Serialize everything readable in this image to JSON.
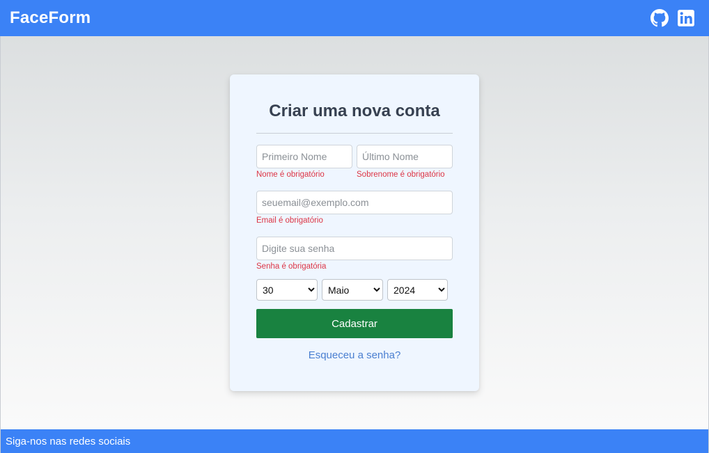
{
  "app": {
    "brand": "FaceForm"
  },
  "header": {
    "social_icons": [
      "github-icon",
      "linkedin-icon"
    ]
  },
  "form": {
    "title": "Criar uma nova conta",
    "first_name": {
      "placeholder": "Primeiro Nome",
      "value": "",
      "error": "Nome é obrigatório"
    },
    "last_name": {
      "placeholder": "Último Nome",
      "value": "",
      "error": "Sobrenome é obrigatório"
    },
    "email": {
      "placeholder": "seuemail@exemplo.com",
      "value": "",
      "error": "Email é obrigatório"
    },
    "password": {
      "placeholder": "Digite sua senha",
      "value": "",
      "error": "Senha é obrigatória"
    },
    "birth": {
      "day": "30",
      "month": "Maio",
      "year": "2024"
    },
    "submit_label": "Cadastrar",
    "forgot_label": "Esqueceu a senha?"
  },
  "footer": {
    "text": "Siga-nos nas redes sociais"
  },
  "colors": {
    "primary": "#3b82f6",
    "submit": "#198240",
    "error": "#dc3545",
    "link": "#4a7fd0",
    "card_bg": "#eff6ff"
  }
}
